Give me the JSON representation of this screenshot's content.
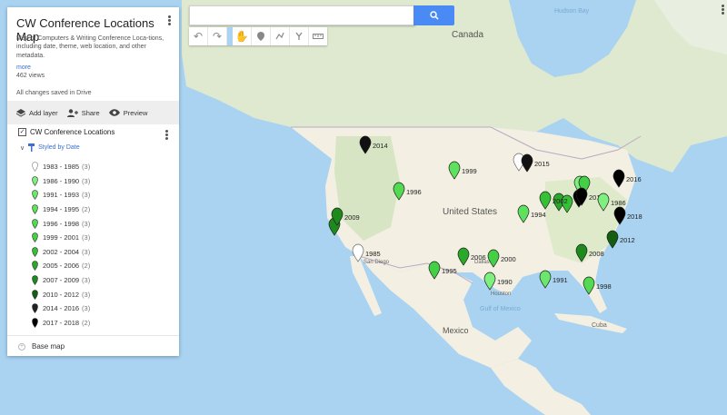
{
  "search": {
    "placeholder": ""
  },
  "panel": {
    "title": "CW Conference Locations Map",
    "description": "Map of Computers & Writing Conference Loca-tions, including date, theme, web location, and other metadata.",
    "more": "more",
    "views": "462 views",
    "saved": "All changes saved in Drive",
    "actions": {
      "add_layer": "Add layer",
      "share": "Share",
      "preview": "Preview"
    },
    "layer": {
      "name": "CW Conference Locations",
      "styled_by": "Styled by Date"
    },
    "legend": [
      {
        "label": "1983 - 1985",
        "count": "(3)",
        "color": "#ffffff"
      },
      {
        "label": "1986 - 1990",
        "count": "(3)",
        "color": "#7ff07f"
      },
      {
        "label": "1991 - 1993",
        "count": "(3)",
        "color": "#6be86b"
      },
      {
        "label": "1994 - 1995",
        "count": "(2)",
        "color": "#5ee25e"
      },
      {
        "label": "1996 - 1998",
        "count": "(3)",
        "color": "#52db52"
      },
      {
        "label": "1999 - 2001",
        "count": "(3)",
        "color": "#44d044"
      },
      {
        "label": "2002 - 2004",
        "count": "(3)",
        "color": "#36c036"
      },
      {
        "label": "2005 - 2006",
        "count": "(2)",
        "color": "#2aa82a"
      },
      {
        "label": "2007 - 2009",
        "count": "(3)",
        "color": "#1e8a1e"
      },
      {
        "label": "2010 - 2012",
        "count": "(3)",
        "color": "#135e13"
      },
      {
        "label": "2014 - 2016",
        "count": "(3)",
        "color": "#222222"
      },
      {
        "label": "2017 - 2018",
        "count": "(2)",
        "color": "#000000"
      }
    ],
    "base_map": "Base map"
  },
  "map_labels": {
    "canada": "Canada",
    "united_states": "United States",
    "mexico": "Mexico",
    "hudson_bay": "Hudson Bay",
    "gulf_of_mexico": "Gulf of Mexico",
    "cuba": "Cuba",
    "san_diego": "San Diego",
    "houston": "Houston",
    "dallas": "Dallas"
  },
  "markers": [
    {
      "year": "2014",
      "color": "#111111",
      "label_side": "right"
    },
    {
      "year": "1999",
      "color": "#5ee25e",
      "label_side": "right"
    },
    {
      "year": "1996",
      "color": "#52db52",
      "label_side": "right"
    },
    {
      "year": "2009",
      "color": "#1e8a1e",
      "label_side": "right"
    },
    {
      "year": "1985",
      "color": "#ffffff",
      "label_side": "right"
    },
    {
      "year": "2015",
      "color": "#111111",
      "label_side": "right"
    },
    {
      "year": "1995",
      "color": "#44d044",
      "label_side": "right"
    },
    {
      "year": "2006",
      "color": "#2aa82a",
      "label_side": "right"
    },
    {
      "year": "2000",
      "color": "#44d044",
      "label_side": "right"
    },
    {
      "year": "1990",
      "color": "#7ff07f",
      "label_side": "right"
    },
    {
      "year": "1994",
      "color": "#5ee25e",
      "label_side": "right"
    },
    {
      "year": "1991",
      "color": "#6be86b",
      "label_side": "right"
    },
    {
      "year": "2002",
      "color": "#36c036",
      "label_side": "right"
    },
    {
      "year": "2017",
      "color": "#000000",
      "label_side": "right"
    },
    {
      "year": "2016",
      "color": "#000000",
      "label_side": "right"
    },
    {
      "year": "1986",
      "color": "#7ff07f",
      "label_side": "right"
    },
    {
      "year": "2018",
      "color": "#000000",
      "label_side": "right"
    },
    {
      "year": "2012",
      "color": "#135e13",
      "label_side": "right"
    },
    {
      "year": "2008",
      "color": "#1e8a1e",
      "label_side": "right"
    },
    {
      "year": "1998",
      "color": "#52db52",
      "label_side": "right"
    }
  ]
}
